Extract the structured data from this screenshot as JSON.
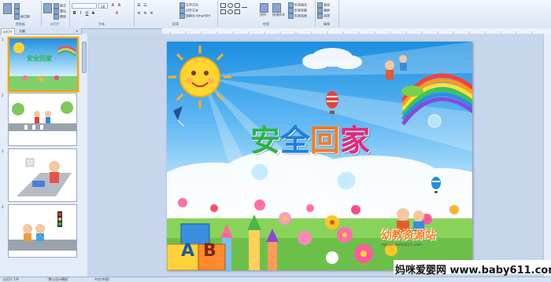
{
  "ribbon": {
    "groups": [
      "剪贴板",
      "幻灯片",
      "字体",
      "段落",
      "绘图",
      "编辑"
    ],
    "clipboard_items": [
      "格式刷"
    ],
    "slides_items": [
      "版式",
      "重设",
      "删除"
    ],
    "font_size": "28",
    "paragraph_items": [
      "文字方向",
      "对齐文本",
      "转换为 SmartArt"
    ],
    "drawing_items": [
      "排列",
      "快速样式",
      "形状填充",
      "形状轮廓",
      "形状效果"
    ],
    "editing_items": [
      "查找",
      "替换",
      "选择"
    ]
  },
  "sidebar": {
    "tabs": [
      "幻灯片",
      "大纲"
    ],
    "slides": [
      {
        "number": "1",
        "title": "安全回家"
      },
      {
        "number": "2",
        "title": ""
      },
      {
        "number": "3",
        "title": ""
      },
      {
        "number": "4",
        "title": ""
      }
    ]
  },
  "slide": {
    "title_chars": [
      "安",
      "全",
      "回",
      "家"
    ],
    "title_colors": [
      "#2bb34a",
      "#1f7fe0",
      "#ff7a1a",
      "#e8247a"
    ],
    "blocks": [
      "A",
      "B"
    ],
    "logo": "幼教资源站",
    "logo_url": "ziyuan.baby611.com"
  },
  "status": {
    "slide_label": "幻灯片 1/9",
    "theme": "\"默认设计模板\"",
    "language": "中文(中国)"
  },
  "watermark": "妈咪爱婴网 www.baby611.com"
}
